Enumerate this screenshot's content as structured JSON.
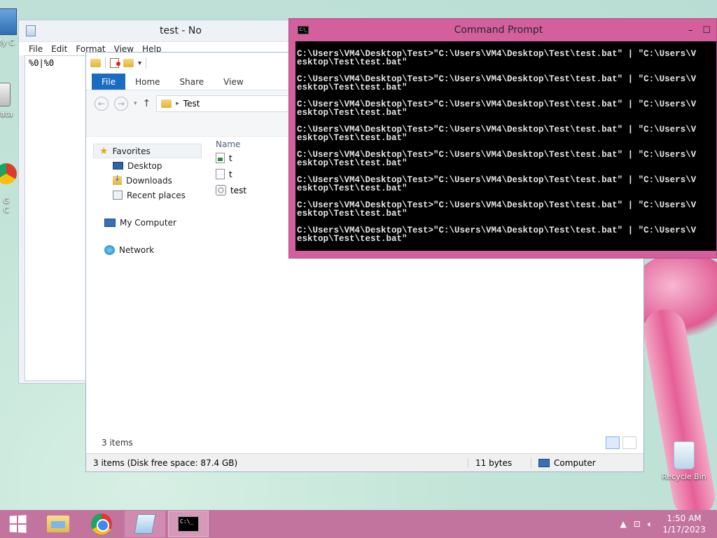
{
  "desktop": {
    "icons": [
      {
        "label": "My C",
        "icon": "computer-icon"
      },
      {
        "label": "Data",
        "icon": "database-icon"
      },
      {
        "label": "G\nC",
        "icon": "chrome-icon"
      }
    ],
    "recycle_bin": {
      "label": "Recycle Bin",
      "icon": "recycle-bin-icon"
    }
  },
  "notepad": {
    "title": "test - No",
    "menu": [
      "File",
      "Edit",
      "Format",
      "View",
      "Help"
    ],
    "content": "%0|%0"
  },
  "explorer": {
    "ribbon_tabs": [
      "File",
      "Home",
      "Share",
      "View"
    ],
    "address": "Test",
    "nav": {
      "favorites": "Favorites",
      "favorites_items": [
        "Desktop",
        "Downloads",
        "Recent places"
      ],
      "computer": "My Computer",
      "network": "Network"
    },
    "column_header": "Name",
    "files": [
      {
        "name": "t",
        "icon": "batch-file-icon"
      },
      {
        "name": "t",
        "icon": "text-file-icon"
      },
      {
        "name": "test",
        "icon": "settings-file-icon"
      }
    ],
    "items_count": "3 items",
    "status": {
      "summary": "3 items (Disk free space: 87.4 GB)",
      "size": "11 bytes",
      "location": "Computer"
    }
  },
  "cmd": {
    "title": "Command Prompt",
    "lines": [
      "C:\\Users\\VM4\\Desktop\\Test>\"C:\\Users\\VM4\\Desktop\\Test\\test.bat\" | \"C:\\Users\\V\nesktop\\Test\\test.bat\"",
      "C:\\Users\\VM4\\Desktop\\Test>\"C:\\Users\\VM4\\Desktop\\Test\\test.bat\" | \"C:\\Users\\V\nesktop\\Test\\test.bat\"",
      "C:\\Users\\VM4\\Desktop\\Test>\"C:\\Users\\VM4\\Desktop\\Test\\test.bat\" | \"C:\\Users\\V\nesktop\\Test\\test.bat\"",
      "C:\\Users\\VM4\\Desktop\\Test>\"C:\\Users\\VM4\\Desktop\\Test\\test.bat\" | \"C:\\Users\\V\nesktop\\Test\\test.bat\"",
      "C:\\Users\\VM4\\Desktop\\Test>\"C:\\Users\\VM4\\Desktop\\Test\\test.bat\" | \"C:\\Users\\V\nesktop\\Test\\test.bat\"",
      "C:\\Users\\VM4\\Desktop\\Test>\"C:\\Users\\VM4\\Desktop\\Test\\test.bat\" | \"C:\\Users\\V\nesktop\\Test\\test.bat\"",
      "C:\\Users\\VM4\\Desktop\\Test>\"C:\\Users\\VM4\\Desktop\\Test\\test.bat\" | \"C:\\Users\\V\nesktop\\Test\\test.bat\"",
      "C:\\Users\\VM4\\Desktop\\Test>\"C:\\Users\\VM4\\Desktop\\Test\\test.bat\" | \"C:\\Users\\V\nesktop\\Test\\test.bat\""
    ],
    "icon_text": "C:\\_"
  },
  "taskbar": {
    "apps": [
      "file-explorer-icon",
      "chrome-icon",
      "notepad-icon",
      "command-prompt-icon"
    ],
    "clock_time": "1:50 AM",
    "clock_date": "1/17/2023"
  },
  "colors": {
    "taskbar": "#c2739e",
    "cmd_frame": "#d35f9c",
    "ribbon_file_tab": "#1a6cc2"
  }
}
